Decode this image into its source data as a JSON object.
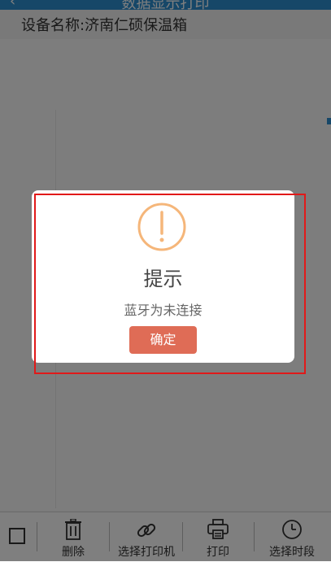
{
  "header": {
    "title": "数据显示打印"
  },
  "device": {
    "label": "设备名称:济南仁硕保温箱"
  },
  "toolbar": {
    "items": [
      {
        "label": "删除",
        "icon": "trash-icon"
      },
      {
        "label": "选择打印机",
        "icon": "link-icon"
      },
      {
        "label": "打印",
        "icon": "printer-icon"
      },
      {
        "label": "选择时段",
        "icon": "clock-icon"
      }
    ],
    "checkbox_icon": "checkbox-icon"
  },
  "dialog": {
    "title": "提示",
    "message": "蓝牙为未连接",
    "confirm_label": "确定",
    "icon": "exclamation-circle-icon",
    "icon_color": "#f5b67a",
    "button_color": "#df6c56"
  },
  "colors": {
    "accent": "#2d8fd0",
    "highlight_border": "#e11919"
  }
}
